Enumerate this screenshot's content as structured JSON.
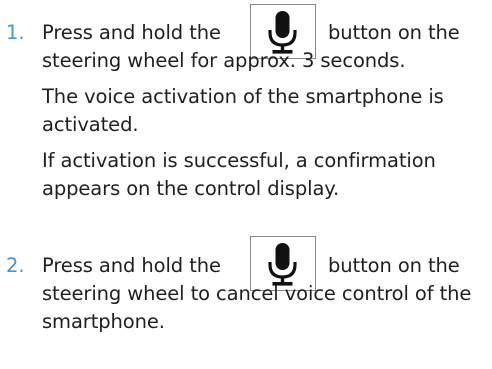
{
  "steps": [
    {
      "number": "1.",
      "before_button": "Press and hold the",
      "after_button": "button on the",
      "line2": "steering wheel for approx. 3 seconds.",
      "result1_line1": "The voice activation of the smartphone is",
      "result1_line2": "activated.",
      "result2_line1": "If activation is successful, a confirmation",
      "result2_line2": "appears on the control display."
    },
    {
      "number": "2.",
      "before_button": "Press and hold the",
      "after_button": "button on the",
      "line2": "steering wheel to cancel voice control of the",
      "line3": "smartphone."
    }
  ],
  "button_icon": "microphone-icon"
}
